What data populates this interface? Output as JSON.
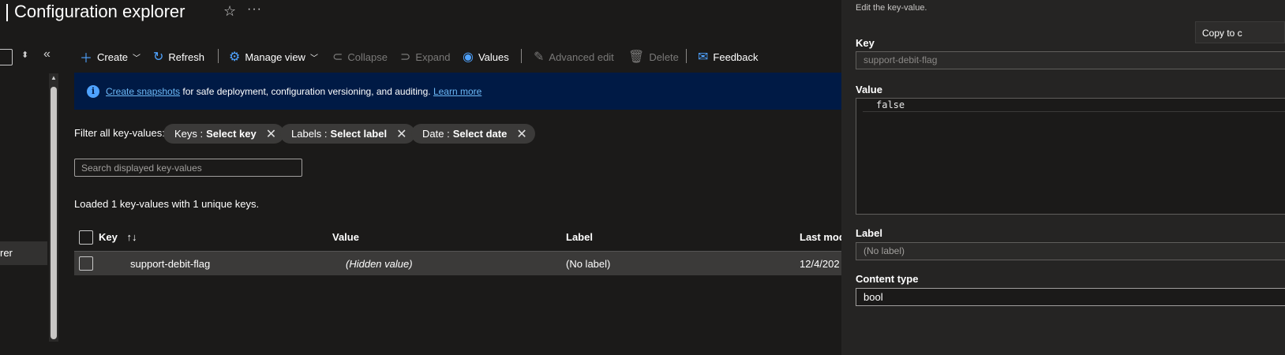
{
  "header": {
    "title": "Configuration explorer",
    "star_icon": "star-icon",
    "more_icon": "more-icon"
  },
  "sidebar": {
    "selected_item_label": "rer"
  },
  "toolbar": {
    "create": "Create",
    "refresh": "Refresh",
    "manage_view": "Manage view",
    "collapse": "Collapse",
    "expand": "Expand",
    "values": "Values",
    "advanced_edit": "Advanced edit",
    "delete": "Delete",
    "feedback": "Feedback"
  },
  "banner": {
    "link_text": "Create snapshots",
    "text": " for safe deployment, configuration versioning, and auditing. ",
    "learn_more": "Learn more"
  },
  "filters": {
    "label": "Filter all key-values:",
    "items": [
      {
        "name": "Keys :",
        "value": "Select key"
      },
      {
        "name": "Labels :",
        "value": "Select label"
      },
      {
        "name": "Date :",
        "value": "Select date"
      }
    ]
  },
  "search": {
    "placeholder": "Search displayed key-values"
  },
  "status": {
    "loaded": "Loaded 1 key-values with 1 unique keys."
  },
  "table": {
    "columns": [
      "Key",
      "Value",
      "Label",
      "Last mod"
    ],
    "rows": [
      {
        "key": "support-debit-flag",
        "value": "(Hidden value)",
        "label": "(No label)",
        "last_modified": "12/4/202"
      }
    ]
  },
  "panel": {
    "description": "Edit the key-value.",
    "copy_tooltip": "Copy to c",
    "key_label": "Key",
    "key_value": "support-debit-flag",
    "value_label": "Value",
    "value_value": "false",
    "label_label": "Label",
    "label_value": "(No label)",
    "content_type_label": "Content type",
    "content_type_value": "bool"
  },
  "colors": {
    "accent": "#4fa3ff",
    "banner_bg": "#001a45",
    "background": "#1b1a19",
    "panel_bg": "#252423"
  }
}
